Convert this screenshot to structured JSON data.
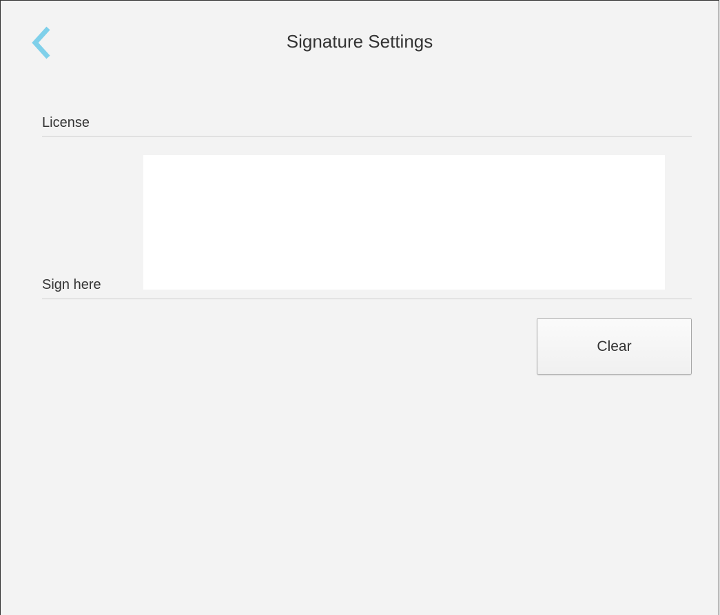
{
  "header": {
    "title": "Signature Settings",
    "back_icon": "chevron-left-icon"
  },
  "license": {
    "label": "License"
  },
  "signature": {
    "label": "Sign here"
  },
  "actions": {
    "clear_label": "Clear"
  },
  "colors": {
    "background": "#f3f3f3",
    "accent": "#7fd0ea",
    "text": "#333333",
    "divider": "#cfcfcf",
    "pad": "#ffffff"
  }
}
